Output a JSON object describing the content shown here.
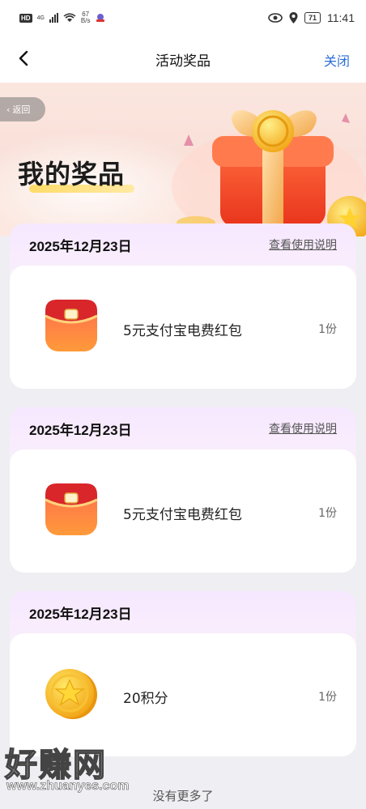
{
  "status_bar": {
    "hd": "HD",
    "network": "4G",
    "net_speed_value": "67",
    "net_speed_unit": "B/s",
    "battery": "71",
    "time": "11:41"
  },
  "nav": {
    "back_icon": "chevron-left-icon",
    "title": "活动奖品",
    "close_label": "关闭"
  },
  "banner": {
    "back_label": "返回",
    "title": "我的奖品"
  },
  "cards": [
    {
      "date": "2025年12月23日",
      "link": "查看使用说明",
      "prize_icon": "red-packet-icon",
      "prize_name": "5元支付宝电费红包",
      "quantity": "1份"
    },
    {
      "date": "2025年12月23日",
      "link": "查看使用说明",
      "prize_icon": "red-packet-icon",
      "prize_name": "5元支付宝电费红包",
      "quantity": "1份"
    },
    {
      "date": "2025年12月23日",
      "link": "",
      "prize_icon": "gold-coin-icon",
      "prize_name": "20积分",
      "quantity": "1份"
    }
  ],
  "footer": {
    "no_more": "没有更多了"
  },
  "watermark": {
    "logo": "好赚网",
    "url": "www.zhuanyes.com"
  },
  "colors": {
    "accent_link": "#2c6fd6",
    "page_bg": "#efeef3",
    "card_gradient_top": "#f6e8ff"
  }
}
